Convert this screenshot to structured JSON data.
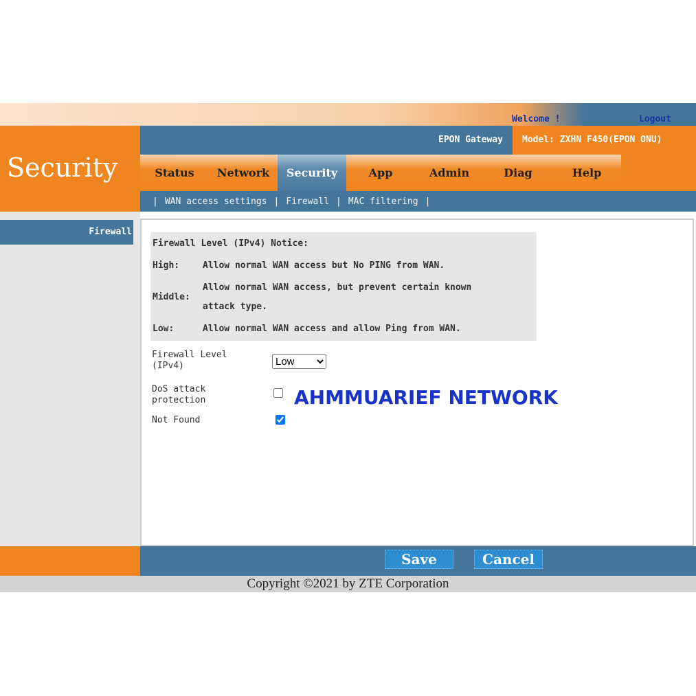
{
  "header": {
    "welcome": "Welcome !",
    "logout": "Logout",
    "gateway": "EPON Gateway",
    "model": "Model: ZXHN F450(EPON ONU)",
    "page_title": "Security"
  },
  "tabs": [
    {
      "label": "Status"
    },
    {
      "label": "Network"
    },
    {
      "label": "Security",
      "active": true
    },
    {
      "label": "App"
    },
    {
      "label": "Admin"
    },
    {
      "label": "Diag"
    },
    {
      "label": "Help"
    }
  ],
  "subnav": {
    "sep": "|",
    "items": [
      "WAN access settings",
      "Firewall",
      "MAC filtering"
    ]
  },
  "sidebar": {
    "items": [
      {
        "label": "Firewall"
      }
    ]
  },
  "notice": {
    "title": "Firewall Level (IPv4) Notice:",
    "rows": [
      {
        "level": "High:",
        "text": "Allow normal WAN access but No PING from WAN."
      },
      {
        "level": "Middle:",
        "text1": "Allow normal WAN access, but prevent certain known",
        "text2": "attack type."
      },
      {
        "level": "Low:",
        "text": "Allow normal WAN access and allow Ping from WAN."
      }
    ]
  },
  "form": {
    "firewall_level_label1": "Firewall Level",
    "firewall_level_label2": "(IPv4)",
    "firewall_level_value": "Low",
    "dos_label1": "DoS attack",
    "dos_label2": "protection",
    "dos_checked": false,
    "notfound_label": "Not Found",
    "notfound_checked": true
  },
  "watermark": "AHMMUARIEF NETWORK",
  "buttons": {
    "save": "Save",
    "cancel": "Cancel"
  },
  "footer": {
    "copyright": "Copyright ©2021 by ZTE Corporation"
  },
  "colors": {
    "orange": "#ef851e",
    "blue": "#44759a",
    "button": "#2d8fd2"
  }
}
